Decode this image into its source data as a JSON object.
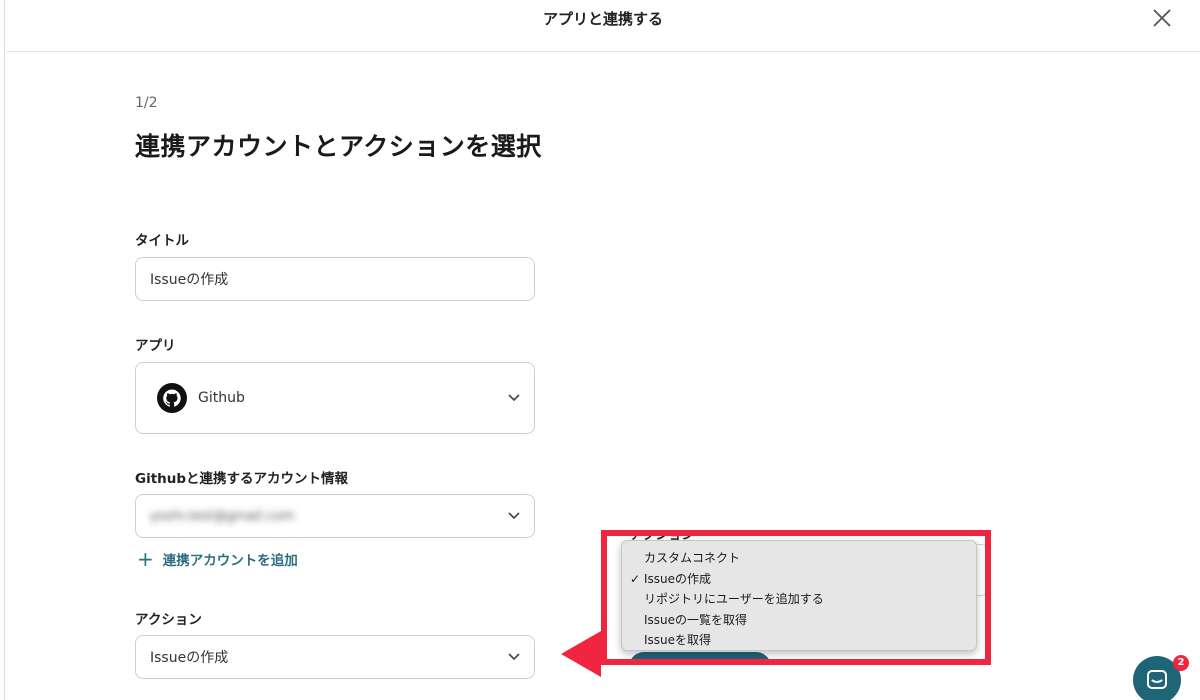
{
  "modal": {
    "title": "アプリと連携する"
  },
  "step": "1/2",
  "heading": "連携アカウントとアクションを選択",
  "title_field": {
    "label": "タイトル",
    "value": "Issueの作成"
  },
  "app_field": {
    "label": "アプリ",
    "value": "Github",
    "icon": "github-icon"
  },
  "account_field": {
    "label": "Githubと連携するアカウント情報",
    "value": "yoshi.test@gmail.com"
  },
  "add_account": {
    "label": "連携アカウントを追加",
    "icon": "plus-icon"
  },
  "action_field": {
    "label": "アクション",
    "value": "Issueの作成"
  },
  "dropdown": {
    "items": [
      {
        "label": "カスタムコネクト",
        "checked": ""
      },
      {
        "label": "Issueの作成",
        "checked": "✓"
      },
      {
        "label": "リポジトリにユーザーを追加する",
        "checked": ""
      },
      {
        "label": "Issueの一覧を取得",
        "checked": ""
      },
      {
        "label": "Issueを取得",
        "checked": ""
      }
    ]
  },
  "chat": {
    "badge": "2",
    "icon": "chat-icon"
  },
  "colors": {
    "accent": "#1f6577",
    "highlight": "#f0253f",
    "link": "#2b6e7f"
  }
}
